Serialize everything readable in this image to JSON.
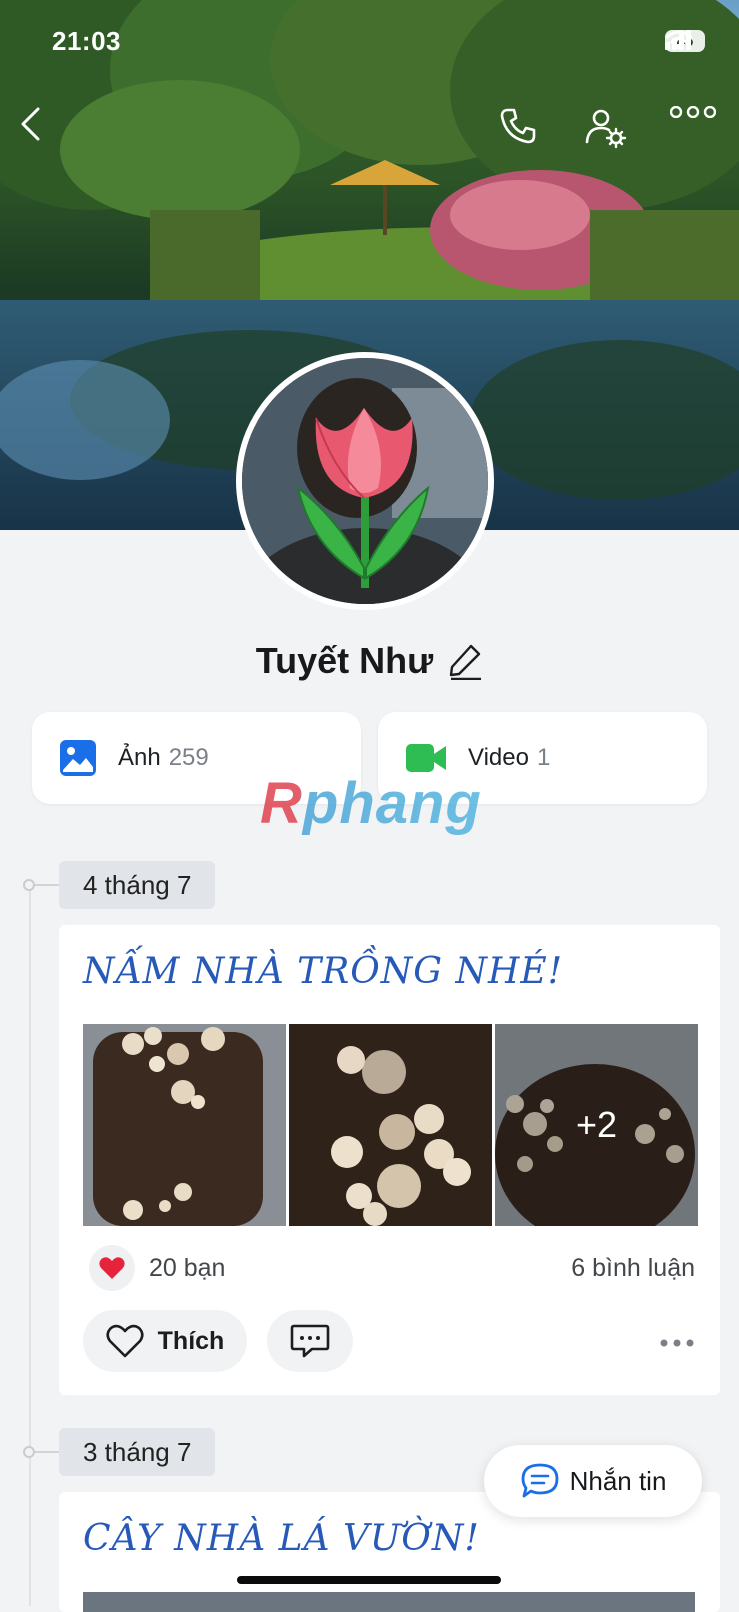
{
  "status_bar": {
    "time": "21:03",
    "battery": "45"
  },
  "profile": {
    "name": "Tuyết Như"
  },
  "media": {
    "photos_label": "Ảnh",
    "photos_count": "259",
    "videos_label": "Video",
    "videos_count": "1"
  },
  "watermark": "Rphang",
  "timeline": [
    {
      "date": "4 tháng 7",
      "title": "NẤM NHÀ TRỒNG NHÉ!",
      "extra_photos": "+2",
      "likes": "20 bạn",
      "comments": "6 bình luận",
      "like_label": "Thích"
    },
    {
      "date": "3 tháng 7",
      "title": "CÂY NHÀ LÁ VƯỜN!"
    }
  ],
  "message_button": {
    "label": "Nhắn tin"
  },
  "colors": {
    "accent_blue": "#2659b8",
    "photo_icon": "#1a6fe8",
    "video_icon": "#2dbd52",
    "heart": "#e5243b"
  }
}
